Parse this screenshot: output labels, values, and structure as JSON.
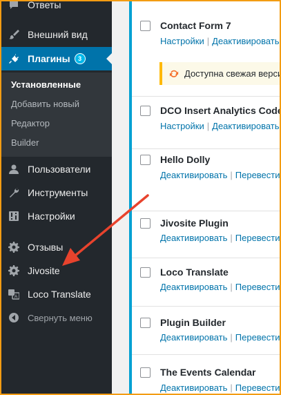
{
  "sidebar": {
    "items_top": [
      {
        "label": "Ответы",
        "icon": "comments-icon"
      },
      {
        "label": "Внешний вид",
        "icon": "paintbrush-icon"
      },
      {
        "label": "Плагины",
        "icon": "plugins-icon",
        "badge": "3"
      }
    ],
    "submenu": [
      "Установленные",
      "Добавить новый",
      "Редактор",
      "Builder"
    ],
    "items_bottom": [
      {
        "label": "Пользователи",
        "icon": "users-icon"
      },
      {
        "label": "Инструменты",
        "icon": "tools-icon"
      },
      {
        "label": "Настройки",
        "icon": "settings-icon"
      },
      {
        "label": "Отзывы",
        "icon": "gear-icon"
      },
      {
        "label": "Jivosite",
        "icon": "gear-icon"
      },
      {
        "label": "Loco Translate",
        "icon": "translate-icon"
      },
      {
        "label": "Свернуть меню",
        "icon": "collapse-icon"
      }
    ]
  },
  "plugins": [
    {
      "name": "Contact Form 7",
      "actions": [
        "Настройки",
        "Деактивировать"
      ]
    },
    {
      "name": "DCO Insert Analytics Code",
      "actions": [
        "Настройки",
        "Деактивировать"
      ]
    },
    {
      "name": "Hello Dolly",
      "actions": [
        "Деактивировать",
        "Перевести"
      ]
    },
    {
      "name": "Jivosite Plugin",
      "actions": [
        "Деактивировать",
        "Перевести"
      ]
    },
    {
      "name": "Loco Translate",
      "actions": [
        "Деактивировать",
        "Перевести"
      ]
    },
    {
      "name": "Plugin Builder",
      "actions": [
        "Деактивировать",
        "Перевести"
      ]
    },
    {
      "name": "The Events Calendar",
      "actions": [
        "Деактивировать",
        "Перевести"
      ]
    }
  ],
  "update_notice": "Доступна свежая версия",
  "colors": {
    "accent": "#0073aa",
    "annotation_arrow": "#e8432d",
    "frame": "#f39c12"
  }
}
